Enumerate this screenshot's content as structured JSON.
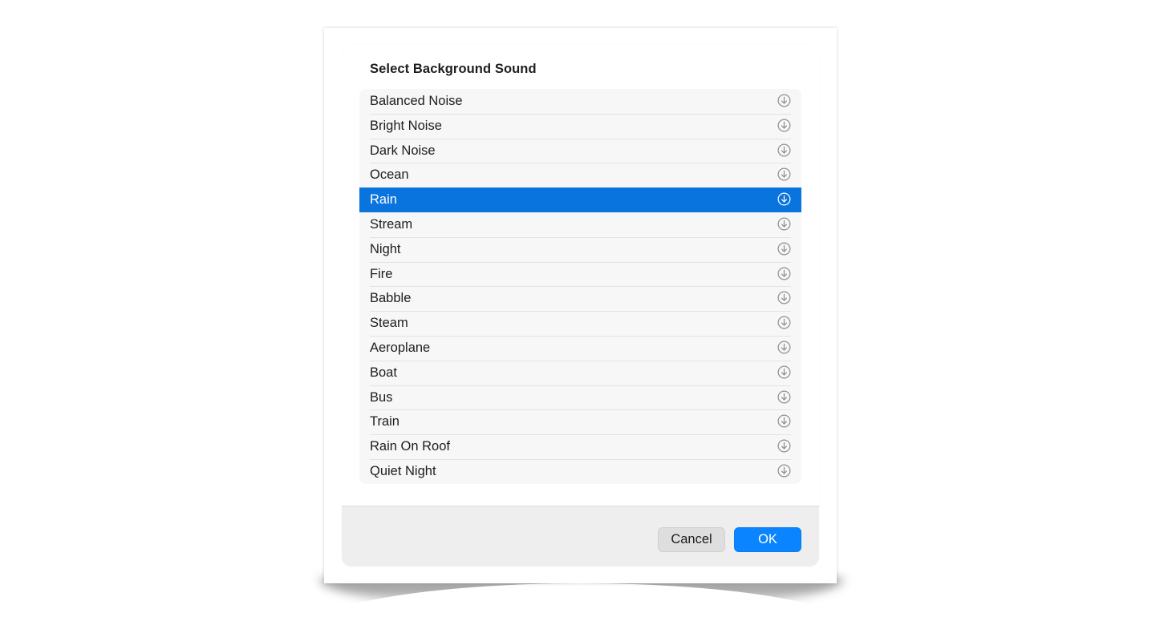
{
  "dialog": {
    "title": "Select Background Sound",
    "selected_index": 4,
    "items": [
      {
        "label": "Balanced Noise",
        "icon": "download-icon"
      },
      {
        "label": "Bright Noise",
        "icon": "download-icon"
      },
      {
        "label": "Dark Noise",
        "icon": "download-icon"
      },
      {
        "label": "Ocean",
        "icon": "download-icon"
      },
      {
        "label": "Rain",
        "icon": "download-icon"
      },
      {
        "label": "Stream",
        "icon": "download-icon"
      },
      {
        "label": "Night",
        "icon": "download-icon"
      },
      {
        "label": "Fire",
        "icon": "download-icon"
      },
      {
        "label": "Babble",
        "icon": "download-icon"
      },
      {
        "label": "Steam",
        "icon": "download-icon"
      },
      {
        "label": "Aeroplane",
        "icon": "download-icon"
      },
      {
        "label": "Boat",
        "icon": "download-icon"
      },
      {
        "label": "Bus",
        "icon": "download-icon"
      },
      {
        "label": "Train",
        "icon": "download-icon"
      },
      {
        "label": "Rain On Roof",
        "icon": "download-icon"
      },
      {
        "label": "Quiet Night",
        "icon": "download-icon"
      }
    ]
  },
  "buttons": {
    "cancel_label": "Cancel",
    "ok_label": "OK"
  },
  "colors": {
    "selection": "#0a74de",
    "primary_button": "#0a84ff",
    "icon_normal": "#8e8e93",
    "icon_selected": "#ffffff"
  }
}
